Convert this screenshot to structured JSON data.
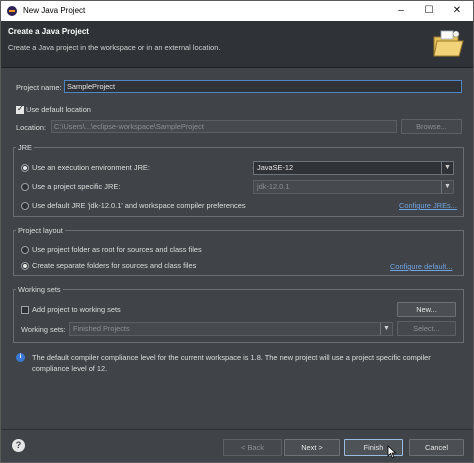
{
  "window": {
    "title": "New Java Project",
    "controls": [
      "–",
      "☐",
      "✕"
    ]
  },
  "header": {
    "title": "Create a Java Project",
    "description": "Create a Java project in the workspace or in an external location."
  },
  "project": {
    "name_label": "Project name:",
    "name_value": "SampleProject",
    "use_default_location_label": "Use default location",
    "use_default_location": true,
    "location_label": "Location:",
    "location_value": "C:\\Users\\...\\eclipse-workspace\\SampleProject",
    "browse_label": "Browse..."
  },
  "jre": {
    "title": "JRE",
    "option_env_label": "Use an execution environment JRE:",
    "option_env_value": "JavaSE-12",
    "option_specific_label": "Use a project specific JRE:",
    "option_specific_value": "jdk-12.0.1",
    "option_default_label": "Use default JRE 'jdk-12.0.1' and workspace compiler preferences",
    "configure_link": "Configure JREs...",
    "selected": "env"
  },
  "layout": {
    "title": "Project layout",
    "option_root_label": "Use project folder as root for sources and class files",
    "option_separate_label": "Create separate folders for sources and class files",
    "configure_link": "Configure default...",
    "selected": "separate"
  },
  "working_sets": {
    "title": "Working sets",
    "add_label": "Add project to working sets",
    "add_checked": false,
    "new_button": "New...",
    "sets_label": "Working sets:",
    "sets_value": "Finished Projects",
    "select_button": "Select..."
  },
  "info": {
    "message": "The default compiler compliance level for the current workspace is 1.8. The new project will use a project specific compiler compliance level of 12."
  },
  "footer": {
    "back": "< Back",
    "next": "Next >",
    "finish": "Finish",
    "cancel": "Cancel"
  }
}
